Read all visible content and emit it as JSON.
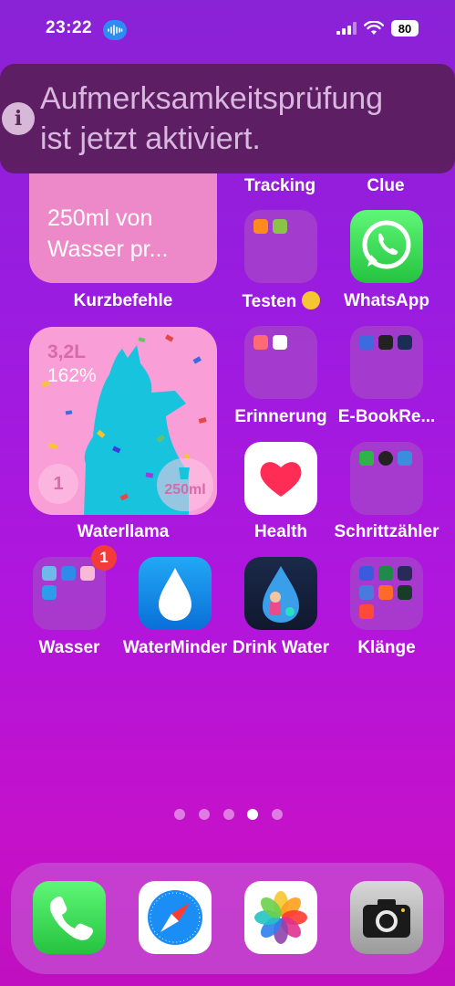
{
  "status": {
    "time": "23:22",
    "battery": "80"
  },
  "banner": {
    "line1": "Aufmerksamkeitsprüfung",
    "line2": "ist jetzt aktiviert."
  },
  "row0": {
    "tracking": "Tracking",
    "clue": "Clue"
  },
  "shortcuts_widget": {
    "text_line1": "250ml von",
    "text_line2": "Wasser pr...",
    "label": "Kurzbefehle"
  },
  "water_widget": {
    "amount": "3,2L",
    "percent": "162%",
    "count": "1",
    "cup": "250ml",
    "label": "Waterllama"
  },
  "apps": {
    "testen": "Testen",
    "whatsapp": "WhatsApp",
    "erinnerung": "Erinnerung",
    "ebook": "E-BookRe...",
    "health": "Health",
    "schritt": "Schrittzähler",
    "wasser": "Wasser",
    "waterminder": "WaterMinder",
    "drinkwater": "Drink Water",
    "klaenge": "Klänge"
  },
  "wasser_badge": "1",
  "page_dots": {
    "count": 5,
    "active": 4
  },
  "dock": [
    "phone-icon",
    "safari-icon",
    "photos-icon",
    "camera-icon"
  ]
}
